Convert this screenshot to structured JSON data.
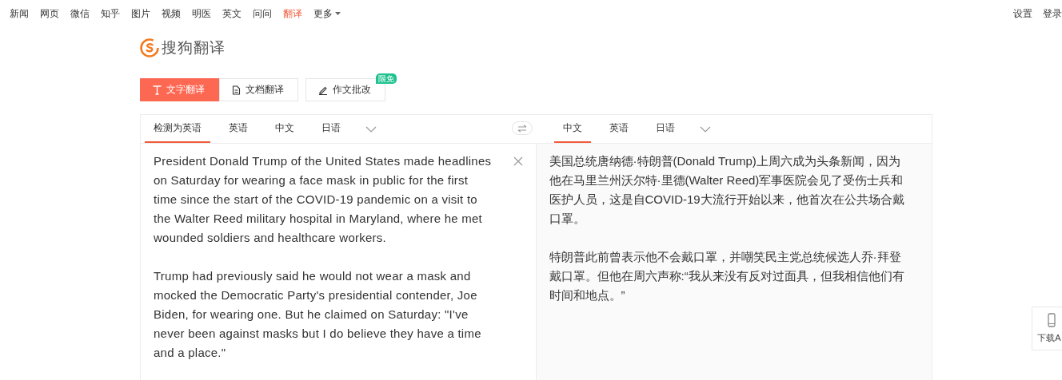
{
  "top_nav": {
    "links": [
      {
        "label": "新闻",
        "selected": false
      },
      {
        "label": "网页",
        "selected": false
      },
      {
        "label": "微信",
        "selected": false
      },
      {
        "label": "知乎",
        "selected": false
      },
      {
        "label": "图片",
        "selected": false
      },
      {
        "label": "视频",
        "selected": false
      },
      {
        "label": "明医",
        "selected": false
      },
      {
        "label": "英文",
        "selected": false
      },
      {
        "label": "问问",
        "selected": false
      },
      {
        "label": "翻译",
        "selected": true
      }
    ],
    "more": "更多",
    "right_links": [
      "设置",
      "登录"
    ]
  },
  "logo": {
    "text": "搜狗翻译"
  },
  "mode_tabs": [
    {
      "label": "文字翻译",
      "kind": "text",
      "selected": true
    },
    {
      "label": "文档翻译",
      "kind": "document",
      "selected": false
    },
    {
      "label": "作文批改",
      "kind": "essay",
      "selected": false,
      "badge": "限免"
    }
  ],
  "source": {
    "languages": [
      {
        "label": "检测为英语",
        "selected": true
      },
      {
        "label": "英语",
        "selected": false
      },
      {
        "label": "中文",
        "selected": false
      },
      {
        "label": "日语",
        "selected": false
      }
    ],
    "paragraphs": [
      "President Donald Trump of the United States made headlines on Saturday for wearing a face mask in public for the first time since the start of the COVID-19 pandemic on a visit to the Walter Reed military hospital in Maryland, where he met wounded soldiers and healthcare workers.",
      "Trump had previously said he would not wear a mask and mocked the Democratic Party's presidential contender, Joe Biden, for wearing one. But he claimed on Saturday: \"I've never been against masks but I do believe they have a time and a place.\""
    ]
  },
  "target": {
    "languages": [
      {
        "label": "中文",
        "selected": true
      },
      {
        "label": "英语",
        "selected": false
      },
      {
        "label": "日语",
        "selected": false
      }
    ],
    "paragraphs": [
      "美国总统唐纳德·特朗普(Donald Trump)上周六成为头条新闻，因为他在马里兰州沃尔特·里德(Walter Reed)军事医院会见了受伤士兵和医护人员，这是自COVID-19大流行开始以来，他首次在公共场合戴口罩。",
      "特朗普此前曾表示他不会戴口罩，并嘲笑民主党总统候选人乔·拜登戴口罩。但他在周六声称:“我从来没有反对过面具，但我相信他们有时间和地点。”"
    ]
  },
  "download_widget": {
    "label": "下载A"
  }
}
